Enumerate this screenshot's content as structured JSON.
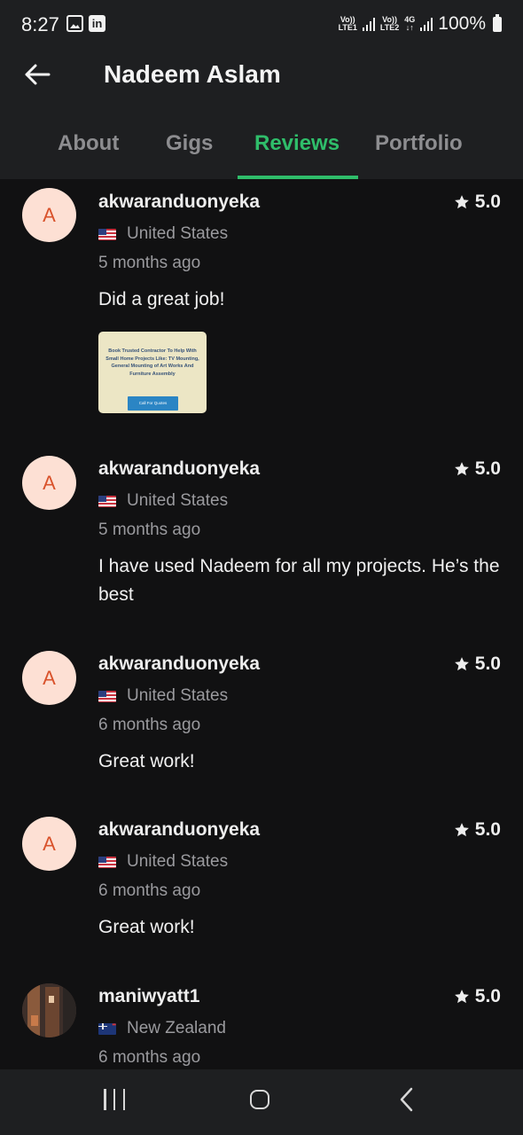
{
  "status_bar": {
    "time": "8:27",
    "sim1": [
      "Vo))",
      "LTE1"
    ],
    "sim2": [
      "Vo))",
      "LTE2"
    ],
    "network": "4G",
    "battery": "100%"
  },
  "header": {
    "title": "Nadeem Aslam",
    "tabs": [
      {
        "label": "About"
      },
      {
        "label": "Gigs"
      },
      {
        "label": "Reviews",
        "active": true
      },
      {
        "label": "Portfolio"
      }
    ]
  },
  "reviews": [
    {
      "avatar_letter": "A",
      "username": "akwaranduonyeka",
      "rating": "5.0",
      "country": "United States",
      "time_ago": "5 months ago",
      "comment": "Did a great job!",
      "attachment": {
        "text": "Book Trusted Contractor To Help With Small Home Projects Like: TV Mounting, General Mounting of Art Works And Furniture Assembly",
        "button": "Call For Quotes"
      }
    },
    {
      "avatar_letter": "A",
      "username": "akwaranduonyeka",
      "rating": "5.0",
      "country": "United States",
      "time_ago": "5 months ago",
      "comment": "I have used Nadeem for all my projects. He’s the best"
    },
    {
      "avatar_letter": "A",
      "username": "akwaranduonyeka",
      "rating": "5.0",
      "country": "United States",
      "time_ago": "6 months ago",
      "comment": "Great work!"
    },
    {
      "avatar_letter": "A",
      "username": "akwaranduonyeka",
      "rating": "5.0",
      "country": "United States",
      "time_ago": "6 months ago",
      "comment": "Great work!"
    },
    {
      "username": "maniwyatt1",
      "rating": "5.0",
      "country": "New Zealand",
      "time_ago": "6 months ago"
    }
  ],
  "colors": {
    "accent": "#2fbd6a",
    "background": "#111112",
    "bar": "#1e1f21",
    "avatar_bg": "#fde0d4",
    "avatar_letter": "#d9532c"
  }
}
